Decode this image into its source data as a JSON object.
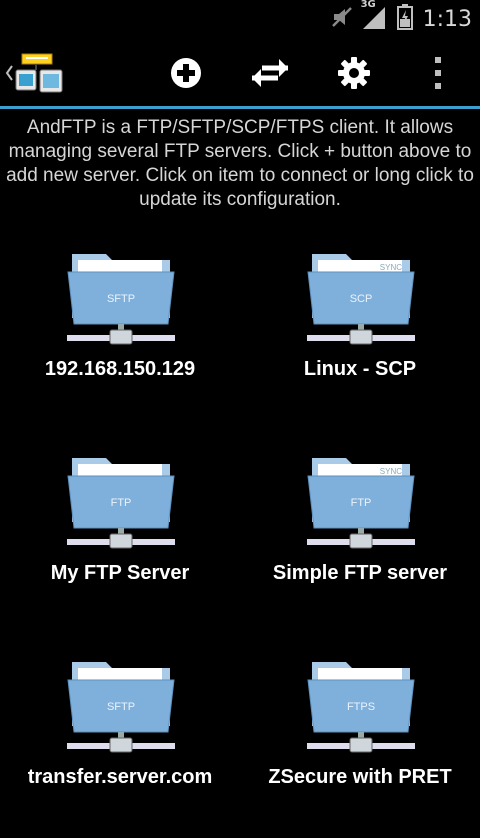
{
  "status": {
    "time": "1:13",
    "network": "3G"
  },
  "actionbar": {
    "add_icon": "add-circle-icon",
    "transfer_icon": "transfer-arrows-icon",
    "settings_icon": "gear-icon",
    "overflow_icon": "overflow-menu-icon"
  },
  "intro": "AndFTP is a FTP/SFTP/SCP/FTPS client. It allows managing several FTP servers. Click + button above to add new server. Click on item to connect or long click to update its configuration.",
  "servers": [
    {
      "name": "192.168.150.129",
      "protocol": "SFTP",
      "sync": ""
    },
    {
      "name": "Linux - SCP",
      "protocol": "SCP",
      "sync": "SYNC"
    },
    {
      "name": "My FTP Server",
      "protocol": "FTP",
      "sync": ""
    },
    {
      "name": "Simple FTP server",
      "protocol": "FTP",
      "sync": "SYNC"
    },
    {
      "name": "transfer.server.com",
      "protocol": "SFTP",
      "sync": ""
    },
    {
      "name": "ZSecure with PRET",
      "protocol": "FTPS",
      "sync": ""
    }
  ],
  "colors": {
    "accent": "#3aa0d0",
    "folder_front": "#7fb0dc",
    "folder_back": "#a9cbe8"
  }
}
